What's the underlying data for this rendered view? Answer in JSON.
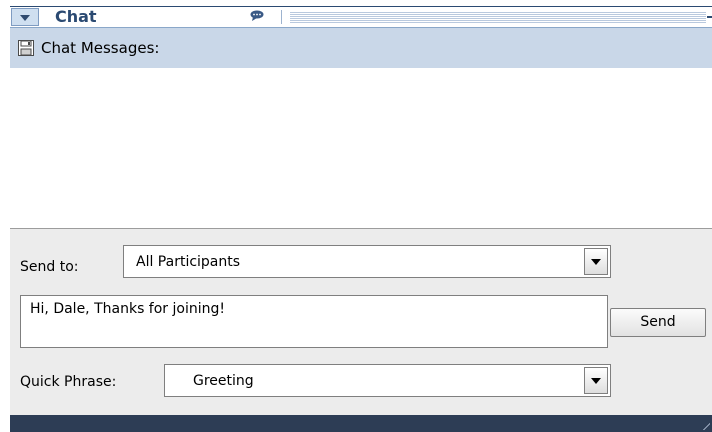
{
  "panel": {
    "title": "Chat",
    "collapse_icon": "chevron-down-icon",
    "chat_icon": "speech-bubble-icon"
  },
  "messages": {
    "header_label": "Chat Messages:",
    "save_icon": "floppy-disk-icon",
    "items": []
  },
  "send_to": {
    "label": "Send to:",
    "selected": "All Participants"
  },
  "compose": {
    "value": "Hi, Dale, Thanks for joining!"
  },
  "send_button": {
    "label": "Send"
  },
  "quick_phrase": {
    "label": "Quick Phrase:",
    "selected": "Greeting"
  },
  "colors": {
    "title_text": "#2b4a72",
    "header_bg": "#c9d7e8",
    "panel_bg": "#ececec",
    "bottom_bar": "#2d3d55"
  }
}
